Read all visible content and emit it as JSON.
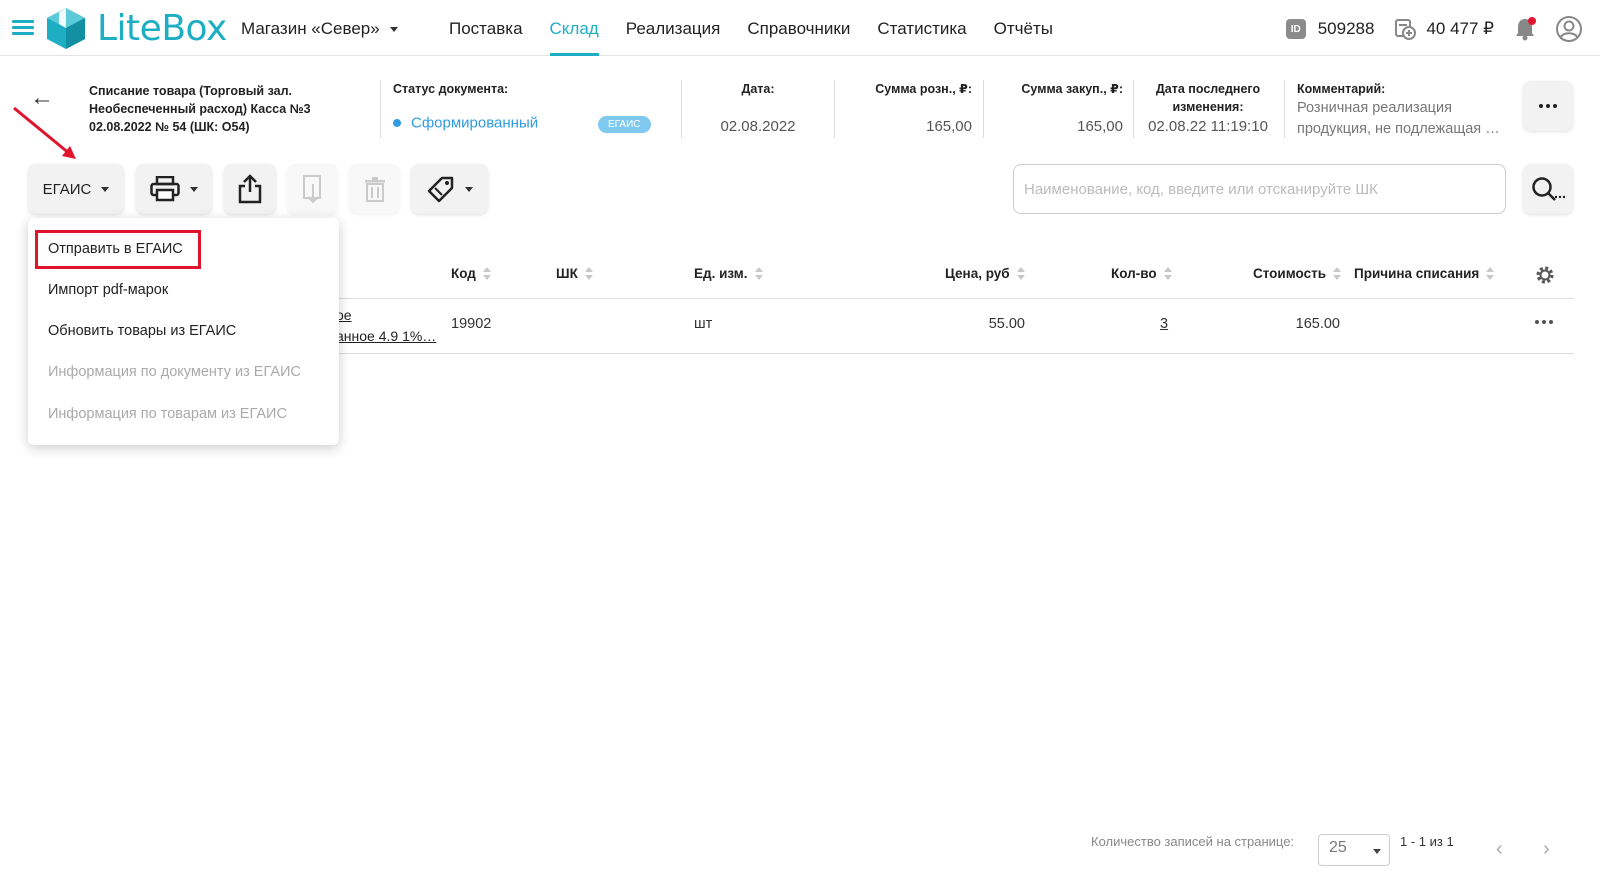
{
  "header": {
    "logo_text": "LiteBox",
    "store": "Магазин «Север»",
    "nav": [
      "Поставка",
      "Склад",
      "Реализация",
      "Справочники",
      "Статистика",
      "Отчёты"
    ],
    "active_nav": "Склад",
    "id_badge": "ID",
    "account_id": "509288",
    "balance": "40 477 ₽"
  },
  "document": {
    "title_line1": "Списание товара (Торговый зал.",
    "title_line2": "Необеспеченный расход) Касса №3",
    "title_line3": "02.08.2022 № 54 (ШК: О54)",
    "status_label": "Статус документа:",
    "status_value": "Сформированный",
    "status_badge": "ЕГАИС",
    "date_label": "Дата:",
    "date_value": "02.08.2022",
    "retail_label": "Сумма розн., ₽:",
    "retail_value": "165,00",
    "purchase_label": "Сумма закуп., ₽:",
    "purchase_value": "165,00",
    "modified_label_1": "Дата последнего",
    "modified_label_2": "изменения:",
    "modified_value": "02.08.22 11:19:10",
    "comment_label": "Комментарий:",
    "comment_line1": "Розничная реализация",
    "comment_line2": "продукция, не подлежащая …"
  },
  "toolbar": {
    "egais_label": "ЕГАИС",
    "search_placeholder": "Наименование, код, введите или отсканируйте ШК"
  },
  "dropdown": {
    "items": [
      {
        "label": "Отправить в ЕГАИС",
        "enabled": true
      },
      {
        "label": "Импорт pdf-марок",
        "enabled": true
      },
      {
        "label": "Обновить товары из ЕГАИС",
        "enabled": true
      },
      {
        "label": "Информация по документу из ЕГАИС",
        "enabled": false
      },
      {
        "label": "Информация по товарам из ЕГАИС",
        "enabled": false
      }
    ]
  },
  "table": {
    "columns": {
      "code": "Код",
      "barcode": "ШК",
      "unit": "Ед. изм.",
      "price": "Цена, руб",
      "qty": "Кол-во",
      "cost": "Стоимость",
      "reason": "Причина списания"
    },
    "rows": [
      {
        "name_line1": "ое",
        "name_line2": "анное 4.9 1%…",
        "code": "19902",
        "barcode": "",
        "unit": "шт",
        "price": "55.00",
        "qty": "3",
        "cost": "165.00",
        "reason": ""
      }
    ]
  },
  "footer": {
    "per_page_label": "Количество записей на странице:",
    "per_page_value": "25",
    "range": "1 - 1 из 1"
  },
  "colors": {
    "brand": "#1eaec4",
    "status": "#2f9be2",
    "highlight": "#e0142d"
  }
}
